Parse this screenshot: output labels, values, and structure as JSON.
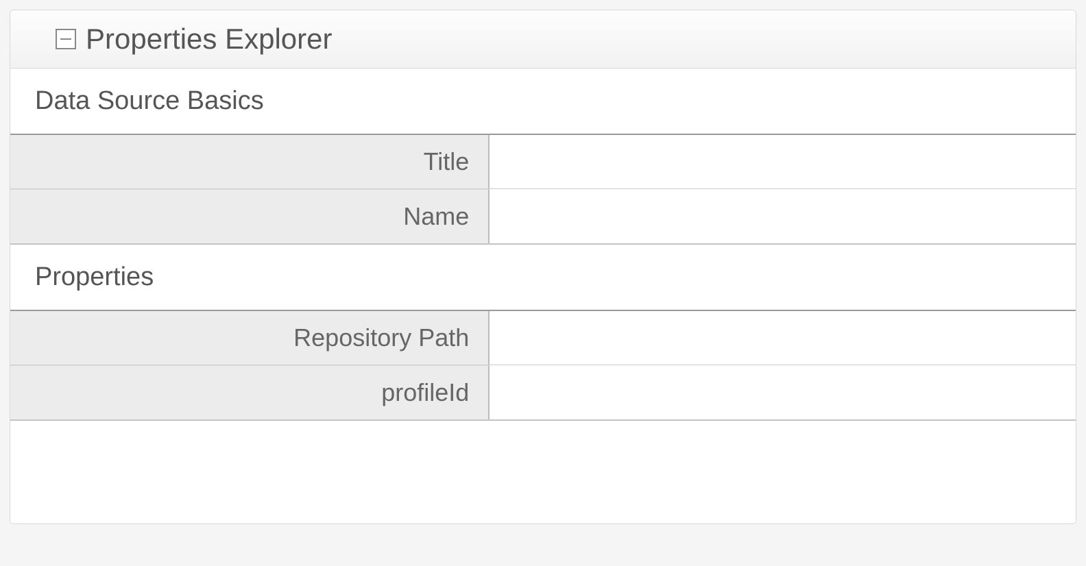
{
  "panel": {
    "title": "Properties Explorer"
  },
  "sections": {
    "basics": {
      "heading": "Data Source Basics",
      "rows": {
        "title": {
          "label": "Title",
          "value": ""
        },
        "name": {
          "label": "Name",
          "value": ""
        }
      }
    },
    "properties": {
      "heading": "Properties",
      "rows": {
        "repositoryPath": {
          "label": "Repository Path",
          "value": ""
        },
        "profileId": {
          "label": "profileId",
          "value": ""
        }
      }
    }
  }
}
